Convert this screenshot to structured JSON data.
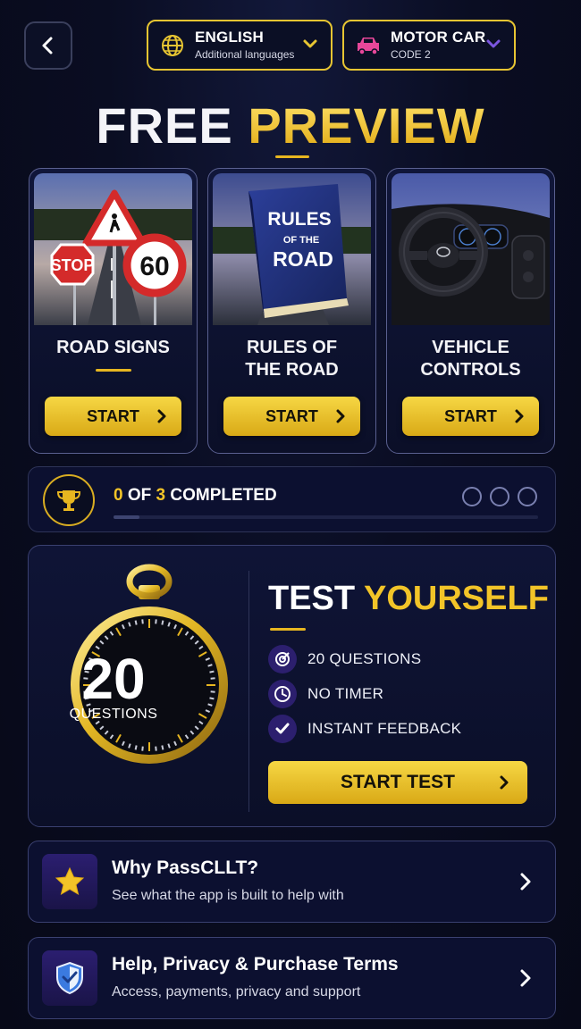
{
  "header": {
    "language": {
      "main": "ENGLISH",
      "sub": "Additional languages"
    },
    "vehicle": {
      "main": "MOTOR CAR",
      "sub": "CODE 2"
    }
  },
  "hero": {
    "title_white": "FREE",
    "title_gold": "PREVIEW"
  },
  "cards": [
    {
      "label_line1": "ROAD SIGNS",
      "label_line2": "",
      "button": "START",
      "image_text": [
        "STOP",
        "60"
      ]
    },
    {
      "label_line1": "RULES OF",
      "label_line2": "THE ROAD",
      "button": "START",
      "image_text": [
        "RULES",
        "OF THE",
        "ROAD"
      ]
    },
    {
      "label_line1": "VEHICLE",
      "label_line2": "CONTROLS",
      "button": "START",
      "image_text": []
    }
  ],
  "progress": {
    "done": "0",
    "of": "OF",
    "total": "3",
    "suffix": "COMPLETED",
    "completed_fraction": 0.06
  },
  "test": {
    "title_white": "TEST",
    "title_gold": "YOURSELF",
    "watch_number": "20",
    "watch_label": "QUESTIONS",
    "features": [
      {
        "icon": "target-icon",
        "text": "20 QUESTIONS"
      },
      {
        "icon": "clock-icon",
        "text": "NO TIMER"
      },
      {
        "icon": "check-icon",
        "text": "INSTANT FEEDBACK"
      }
    ],
    "button": "START TEST"
  },
  "rows": [
    {
      "icon": "star-icon",
      "title": "Why PassCLLT?",
      "subtitle": "See what the app is built to help with"
    },
    {
      "icon": "shield-icon",
      "title": "Help, Privacy & Purchase Terms",
      "subtitle": "Access, payments, privacy and support"
    }
  ],
  "colors": {
    "gold": "#f2c428",
    "background": "#0a0d22",
    "accent_purple": "#2c1f6e"
  }
}
